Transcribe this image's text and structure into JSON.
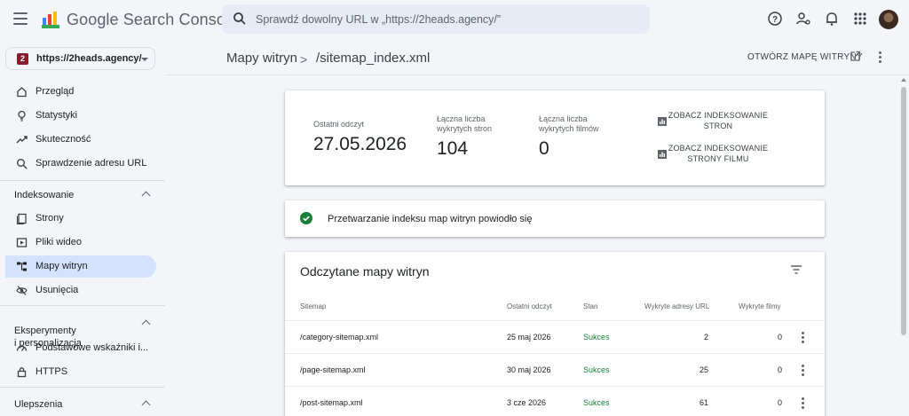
{
  "app": {
    "brand": "Google Search Console",
    "search_placeholder": "Sprawdź dowolny URL w „https://2heads.agency/”"
  },
  "property": {
    "label": "https://2heads.agency/",
    "badge": "2"
  },
  "sidebar": {
    "items_top": [
      {
        "label": "Przegląd",
        "icon": "home-icon"
      },
      {
        "label": "Statystyki",
        "icon": "lightbulb-icon"
      },
      {
        "label": "Skuteczność",
        "icon": "trending-up-icon"
      },
      {
        "label": "Sprawdzenie adresu URL",
        "icon": "search-icon"
      }
    ],
    "section_indexing": "Indeksowanie",
    "items_indexing": [
      {
        "label": "Strony",
        "icon": "pages-icon"
      },
      {
        "label": "Pliki wideo",
        "icon": "video-icon"
      },
      {
        "label": "Mapy witryn",
        "icon": "sitemap-icon",
        "active": true
      },
      {
        "label": "Usunięcia",
        "icon": "eye-off-icon"
      }
    ],
    "section_experiments": "Eksperymenty\ni personalizacja",
    "items_experiments": [
      {
        "label": "Podstawowe wskaźniki i...",
        "icon": "gauge-icon"
      },
      {
        "label": "HTTPS",
        "icon": "lock-icon"
      }
    ],
    "section_enhancements": "Ulepszenia"
  },
  "header": {
    "crumb_parent": "Mapy witryn",
    "crumb_separator": ">",
    "crumb_current": "/sitemap_index.xml",
    "open_sitemap": "OTWÓRZ MAPĘ WITRYNY"
  },
  "summary": {
    "last_read_label": "Ostatni odczyt",
    "last_read_value": "27.05.2026",
    "pages_label": "Łączna liczba\nwykrytych stron",
    "pages_value": "104",
    "videos_label": "Łączna liczba\nwykrytych filmów",
    "videos_value": "0",
    "see_pages_indexing": "ZOBACZ INDEKSOWANIE\nSTRON",
    "see_video_indexing": "ZOBACZ INDEKSOWANIE\nSTRONY FILMU"
  },
  "status": {
    "text": "Przetwarzanie indeksu map witryn powiodło się"
  },
  "table": {
    "title": "Odczytane mapy witryn",
    "headers": [
      "Sitemap",
      "Ostatni odczyt",
      "Stan",
      "Wykryte adresy URL",
      "Wykryte filmy"
    ],
    "rows": [
      {
        "sitemap": "/category-sitemap.xml",
        "last_read": "25 maj 2026",
        "status": "Sukces",
        "urls": "2",
        "videos": "0"
      },
      {
        "sitemap": "/page-sitemap.xml",
        "last_read": "30 maj 2026",
        "status": "Sukces",
        "urls": "25",
        "videos": "0"
      },
      {
        "sitemap": "/post-sitemap.xml",
        "last_read": "3 cze 2026",
        "status": "Sukces",
        "urls": "61",
        "videos": "0"
      }
    ]
  },
  "colors": {
    "background": "#f3f5f9",
    "active_nav": "#d3e3fd",
    "success": "#188038",
    "property_badge": "#8b1a2b"
  }
}
